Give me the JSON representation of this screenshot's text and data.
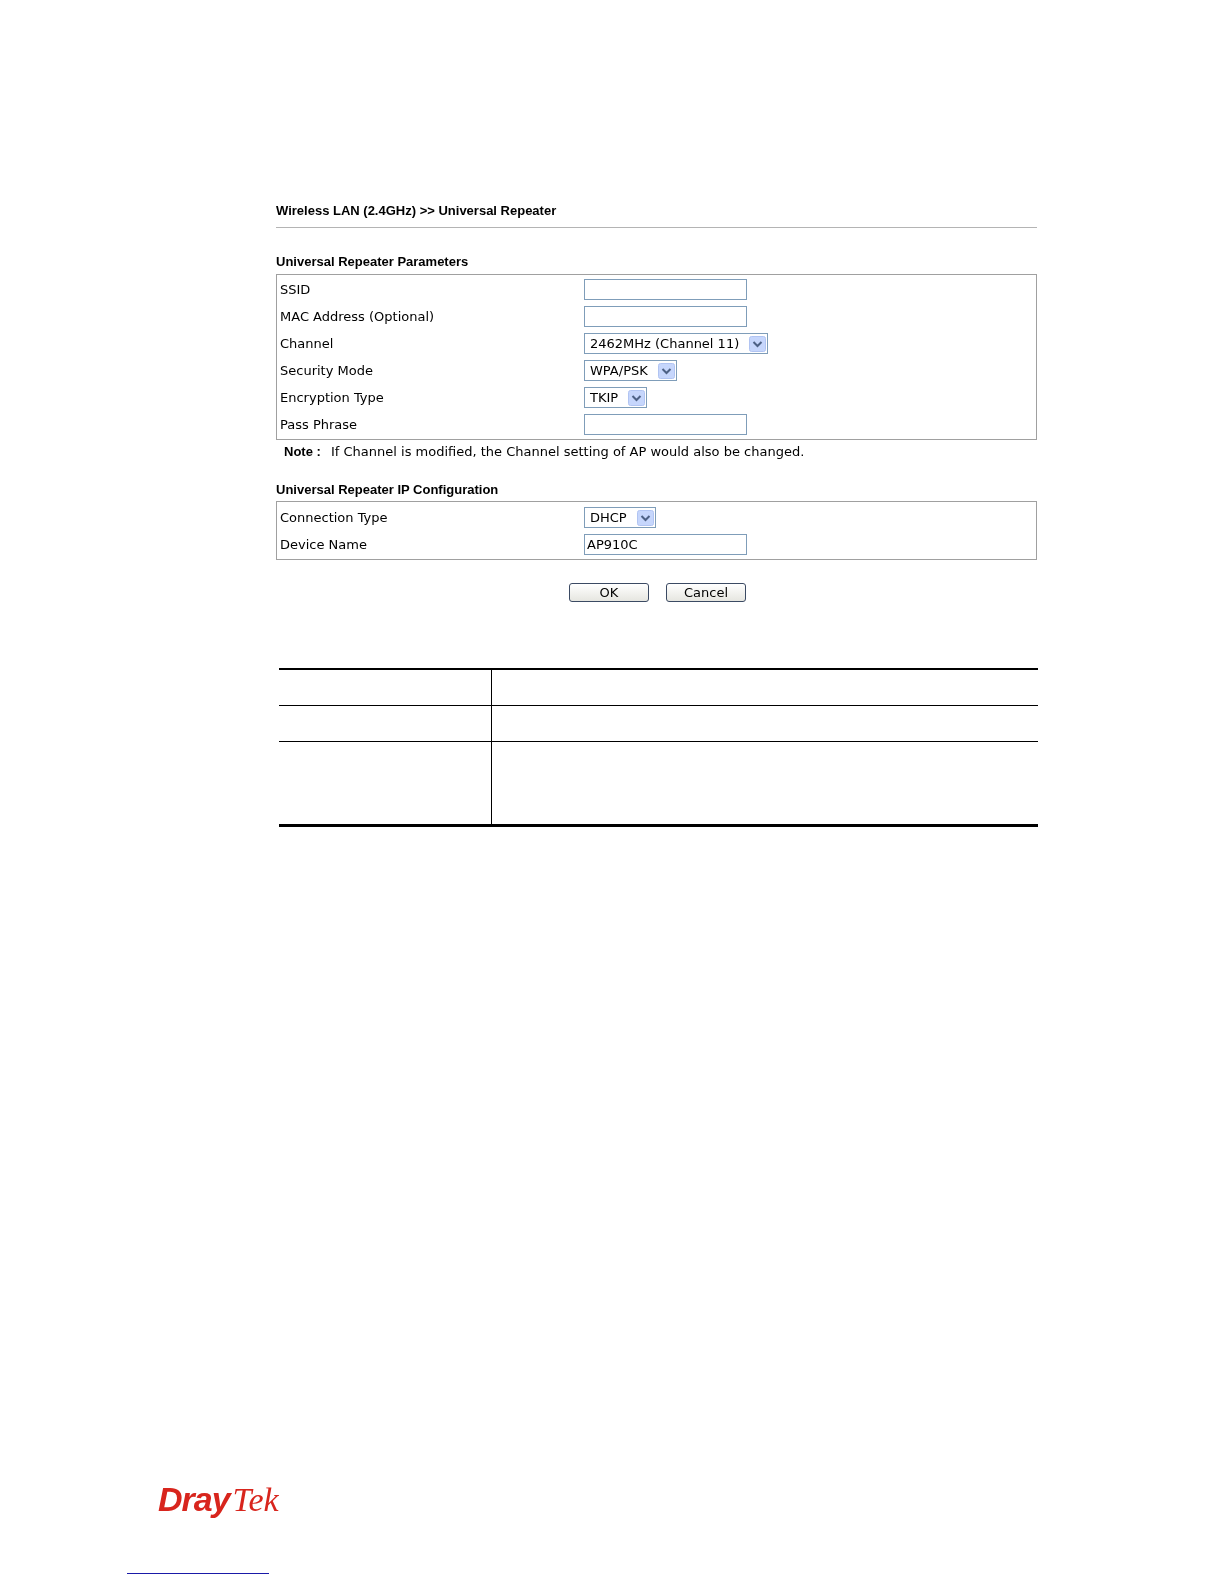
{
  "page_title": "Wireless LAN (2.4GHz) >> Universal Repeater",
  "sections": [
    {
      "title": "Universal Repeater Parameters",
      "fields": [
        {
          "label": "SSID",
          "kind": "text"
        },
        {
          "label": "MAC Address (Optional)",
          "kind": "text"
        },
        {
          "label": "Channel",
          "kind": "select",
          "value": "2462MHz (Channel 11)"
        },
        {
          "label": "Security Mode",
          "kind": "select",
          "value": "WPA/PSK"
        },
        {
          "label": "Encryption Type",
          "kind": "select",
          "value": "TKIP"
        },
        {
          "label": "Pass Phrase",
          "kind": "text"
        }
      ],
      "note": "**Note :** If Channel is modified, the Channel setting of AP would also be changed."
    },
    {
      "title": "Universal Repeater IP Configuration",
      "fields": [
        {
          "label": "Connection Type",
          "kind": "select",
          "value": "DHCP"
        },
        {
          "label": "Device Name",
          "kind": "text",
          "value": "AP910C"
        }
      ]
    }
  ],
  "buttons": [
    "OK",
    "Cancel"
  ],
  "logo": "**Dray**Tek"
}
